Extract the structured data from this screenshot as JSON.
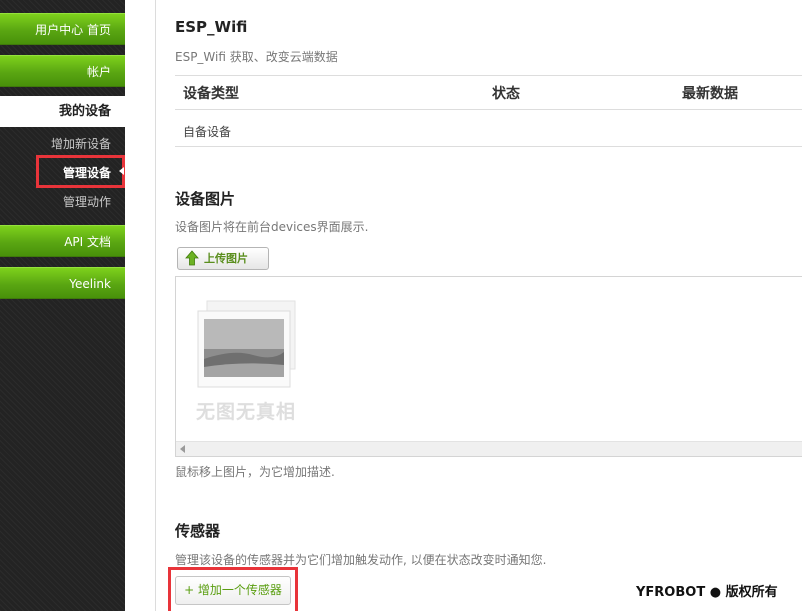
{
  "sidebar": {
    "user_center": "用户中心 首页",
    "account": "帐户",
    "my_devices": "我的设备",
    "add_device": "增加新设备",
    "manage_devices": "管理设备",
    "manage_actions": "管理动作",
    "api_docs": "API 文档",
    "yeelink": "Yeelink"
  },
  "device": {
    "title": "ESP_Wifi",
    "description": "ESP_Wifi 获取、改变云端数据"
  },
  "device_table": {
    "columns": [
      "设备类型",
      "状态",
      "最新数据"
    ],
    "rows": [
      [
        "自备设备",
        "",
        ""
      ]
    ]
  },
  "device_image": {
    "title": "设备图片",
    "description": "设备图片将在前台devices界面展示.",
    "upload_label": "上传图片",
    "placeholder_text": "无图无真相",
    "hint": "鼠标移上图片，为它增加描述."
  },
  "sensors": {
    "title": "传感器",
    "description": "管理该设备的传感器并为它们增加触发动作, 以便在状态改变时通知您.",
    "add_button": "+ 增加一个传感器"
  },
  "footer": {
    "brand": "YFROBOT ● 版权所有"
  },
  "colors": {
    "accent_green": "#5aa612",
    "highlight_red": "#e8343a",
    "sidebar_bg": "#232323"
  }
}
